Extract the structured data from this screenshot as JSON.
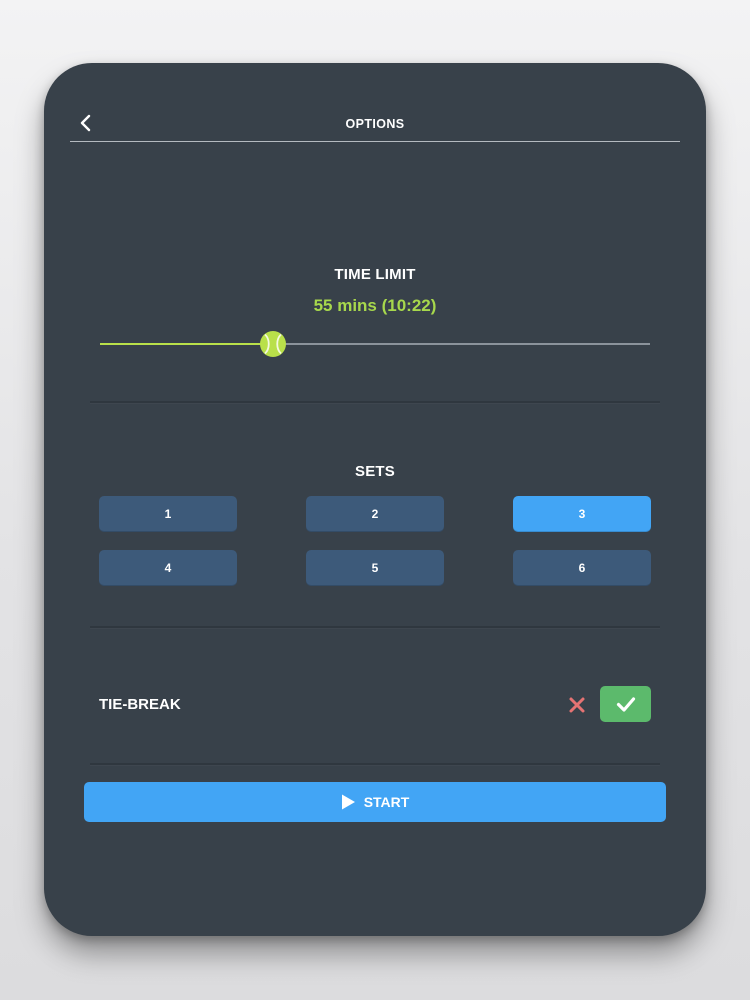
{
  "header": {
    "title": "OPTIONS"
  },
  "time_limit": {
    "label": "TIME LIMIT",
    "value_text": "55 mins (10:22)",
    "slider_fraction": 0.315
  },
  "sets": {
    "label": "SETS",
    "options": [
      "1",
      "2",
      "3",
      "4",
      "5",
      "6"
    ],
    "selected": "3"
  },
  "tiebreak": {
    "label": "TIE-BREAK",
    "enabled": true
  },
  "start": {
    "label": "START"
  },
  "colors": {
    "panel": "#38414a",
    "accent_blue": "#42a5f5",
    "button_blue": "#3d5a7a",
    "lime": "#a7d84c",
    "check_green": "#5cba6c",
    "cross_red": "#e57373"
  },
  "icons": {
    "back": "chevron-left-icon",
    "slider_thumb": "tennis-ball-icon",
    "no": "close-icon",
    "yes": "check-icon",
    "start": "play-icon"
  }
}
